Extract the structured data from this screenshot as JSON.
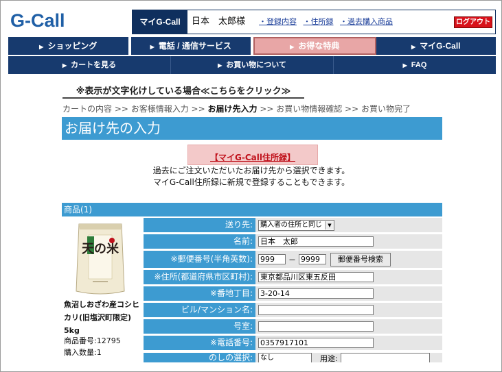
{
  "brand": {
    "logo": "G-Call",
    "accent": "#3d9bd1",
    "navy": "#173a6e"
  },
  "header": {
    "my_tag": "マイG-Call",
    "username": "日本　太郎様",
    "links": [
      "・登録内容",
      "・住所録",
      "・過去購入商品"
    ],
    "logout": "ログアウト"
  },
  "nav_main": [
    {
      "label": "ショッピング",
      "active": false
    },
    {
      "label": "電話 / 通信サービス",
      "active": false
    },
    {
      "label": "お得な特典",
      "active": true
    },
    {
      "label": "マイG-Call",
      "active": false
    }
  ],
  "nav_sub": [
    {
      "label": "カートを見る"
    },
    {
      "label": "お買い物について"
    },
    {
      "label": "FAQ"
    }
  ],
  "notice": "※表示が文字化けしている場合≪こちらをクリック≫",
  "steps": {
    "s1": "カートの内容 >> お客様情報入力 >> ",
    "current": "お届け先入力",
    "s2": " >> お買い物情報確認 >> お買い物完了"
  },
  "page_title": "お届け先の入力",
  "address_book": {
    "button": "【マイG-Call住所録】",
    "desc1": "過去にご注文いただいたお届け先から選択できます。",
    "desc2": "マイG-Call住所録に新規で登録することもできます。"
  },
  "product": {
    "heading": "商品(1)",
    "name": "魚沼しおざわ産コシヒカリ(旧塩沢町限定) 5kg",
    "code": "商品番号:12795",
    "qty": "購入数量:1",
    "bag_text": "天の米"
  },
  "form": {
    "send_to_label": "送り先:",
    "send_to_value": "購入者の住所と同じ",
    "name_label": "名前:",
    "name_value": "日本　太郎",
    "zip_label": "※郵便番号(半角英数):",
    "zip1": "999",
    "zip_sep": "－",
    "zip2": "9999",
    "zip_button": "郵便番号検索",
    "addr_label": "※住所(都道府県市区町村):",
    "addr_value": "東京都品川区東五反田",
    "street_label": "※番地丁目:",
    "street_value": "3-20-14",
    "building_label": "ビル/マンション名:",
    "building_value": "",
    "room_label": "号室:",
    "room_value": "",
    "phone_label": "※電話番号:",
    "phone_value": "0357917101",
    "noshi_label": "のしの選択:",
    "noshi_value": "なし",
    "use_label": "用途:"
  }
}
